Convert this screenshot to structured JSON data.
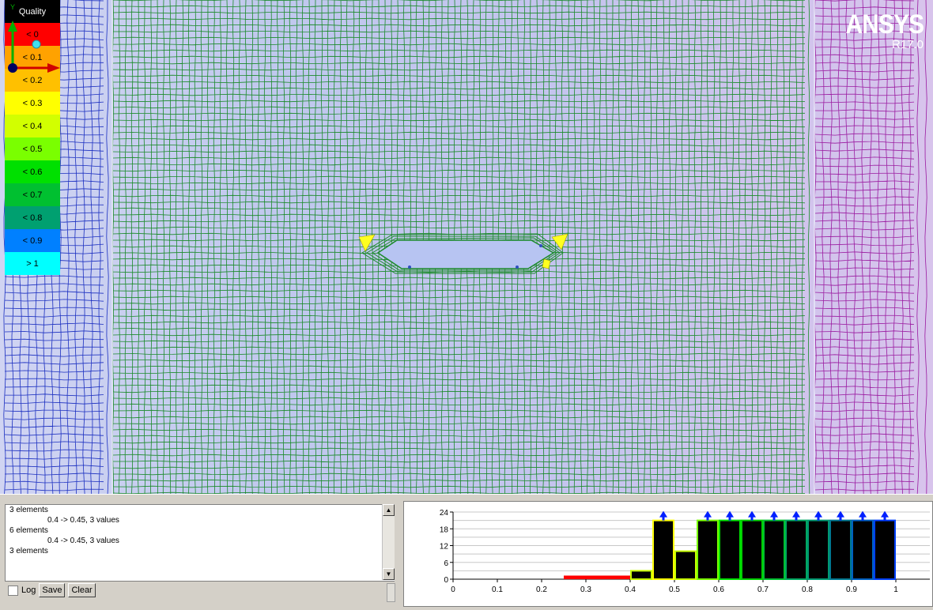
{
  "legend": {
    "title": "Quality",
    "bins": [
      {
        "label": "< 0",
        "color": "#ff0000"
      },
      {
        "label": "< 0.1",
        "color": "#ffa200"
      },
      {
        "label": "< 0.2",
        "color": "#ffc000"
      },
      {
        "label": "< 0.3",
        "color": "#ffff00"
      },
      {
        "label": "< 0.4",
        "color": "#d2ff00"
      },
      {
        "label": "< 0.5",
        "color": "#7aff00"
      },
      {
        "label": "< 0.6",
        "color": "#00e000"
      },
      {
        "label": "< 0.7",
        "color": "#00c030"
      },
      {
        "label": "< 0.8",
        "color": "#00a070"
      },
      {
        "label": "< 0.9",
        "color": "#0080ff"
      },
      {
        "label": "> 1",
        "color": "#00ffff"
      }
    ]
  },
  "logo": {
    "brand": "ANSYS",
    "version": "R17.0"
  },
  "triad": {
    "y_label": "Y"
  },
  "messages": [
    {
      "text": "3 elements",
      "indent": false
    },
    {
      "text": "0.4 -> 0.45, 3 values",
      "indent": true
    },
    {
      "text": "6 elements",
      "indent": false
    },
    {
      "text": "0.4 -> 0.45, 3 values",
      "indent": true
    },
    {
      "text": "3 elements",
      "indent": false
    }
  ],
  "controls": {
    "log_label": "Log",
    "log_checked": false,
    "save_label": "Save",
    "clear_label": "Clear"
  },
  "chart_data": {
    "type": "bar",
    "xlim": [
      0,
      1
    ],
    "ylim": [
      0,
      24
    ],
    "x_ticks": [
      "0",
      "0.1",
      "0.2",
      "0.3",
      "0.4",
      "0.5",
      "0.6",
      "0.7",
      "0.8",
      "0.9",
      "1"
    ],
    "y_ticks": [
      "0",
      "6",
      "12",
      "18",
      "24"
    ],
    "bin_width": 0.05,
    "bins": [
      {
        "start": 0.25,
        "value": 1,
        "outline": "#ff0000",
        "arrow": false
      },
      {
        "start": 0.3,
        "value": 1,
        "outline": "#ff0000",
        "arrow": false
      },
      {
        "start": 0.35,
        "value": 1,
        "outline": "#ff0000",
        "arrow": false
      },
      {
        "start": 0.4,
        "value": 3,
        "outline": "#c8ff00",
        "arrow": false
      },
      {
        "start": 0.45,
        "value": 21,
        "outline": "#ffff00",
        "arrow": true
      },
      {
        "start": 0.5,
        "value": 10,
        "outline": "#c8ff00",
        "arrow": false
      },
      {
        "start": 0.55,
        "value": 21,
        "outline": "#7aff00",
        "arrow": true
      },
      {
        "start": 0.6,
        "value": 21,
        "outline": "#00e000",
        "arrow": true
      },
      {
        "start": 0.65,
        "value": 21,
        "outline": "#00d000",
        "arrow": true
      },
      {
        "start": 0.7,
        "value": 21,
        "outline": "#00c030",
        "arrow": true
      },
      {
        "start": 0.75,
        "value": 21,
        "outline": "#00a860",
        "arrow": true
      },
      {
        "start": 0.8,
        "value": 21,
        "outline": "#009870",
        "arrow": true
      },
      {
        "start": 0.85,
        "value": 21,
        "outline": "#007890",
        "arrow": true
      },
      {
        "start": 0.9,
        "value": 21,
        "outline": "#0060c0",
        "arrow": true
      },
      {
        "start": 0.95,
        "value": 21,
        "outline": "#0040ff",
        "arrow": true
      }
    ]
  }
}
